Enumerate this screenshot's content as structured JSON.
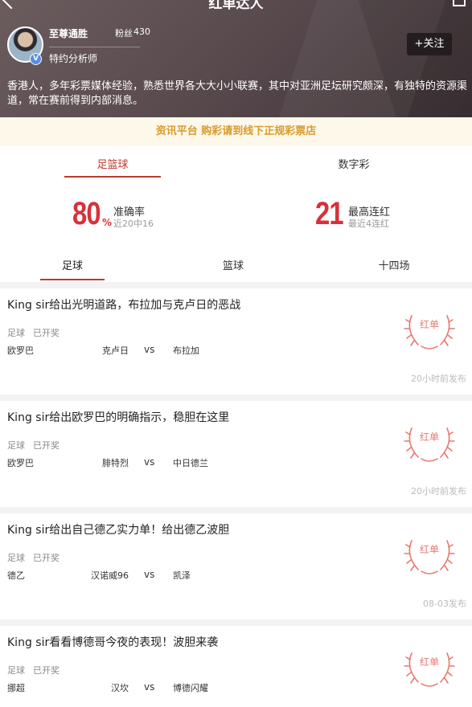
{
  "topbar": {
    "title": "红单达人",
    "back_icon": "back-arrow-icon",
    "share_icon": "share-icon"
  },
  "profile": {
    "name": "至尊通胜",
    "fans_label": "粉丝",
    "fans_count": "430",
    "role": "特约分析师",
    "verified_badge": "V",
    "follow_label": "+关注",
    "bio": "香港人，多年彩票媒体经验，熟悉世界各大大小小联赛，其中对亚洲足坛研究颇深，有独特的资源渠道，常在赛前得到内部消息。"
  },
  "notice": "资讯平台 购彩请到线下正规彩票店",
  "main_tabs": [
    "足篮球",
    "数字彩"
  ],
  "stats": {
    "accuracy_value": "80",
    "accuracy_pct": "%",
    "accuracy_label": "准确率",
    "accuracy_sub": "近20中16",
    "streak_value": "21",
    "streak_label": "最高连红",
    "streak_sub": "最近4连红"
  },
  "sub_tabs": [
    "足球",
    "篮球",
    "十四场"
  ],
  "cards": [
    {
      "title": "King sir给出光明道路，布拉加与克卢日的恶战",
      "sport": "足球",
      "status": "已开奖",
      "league": "欧罗巴",
      "home": "克卢日",
      "vs": "vs",
      "away": "布拉加",
      "time": "20小时前发布",
      "stamp": "红单"
    },
    {
      "title": "King sir给出欧罗巴的明确指示，稳胆在这里",
      "sport": "足球",
      "status": "已开奖",
      "league": "欧罗巴",
      "home": "腓特烈",
      "vs": "vs",
      "away": "中日德兰",
      "time": "20小时前发布",
      "stamp": "红单"
    },
    {
      "title": "King sir给出自己德乙实力单！给出德乙波胆",
      "sport": "足球",
      "status": "已开奖",
      "league": "德乙",
      "home": "汉诺威96",
      "vs": "vs",
      "away": "凯泽",
      "time": "08-03发布",
      "stamp": "红单"
    },
    {
      "title": "King sir看看博德哥今夜的表现！波胆来袭",
      "sport": "足球",
      "status": "已开奖",
      "league": "挪超",
      "home": "汉坎",
      "vs": "vs",
      "away": "博德闪耀",
      "time": "",
      "stamp": "红单"
    }
  ],
  "colors": {
    "accent": "#d8313a",
    "notice_text": "#d99a2c",
    "stamp": "#e8796f"
  }
}
